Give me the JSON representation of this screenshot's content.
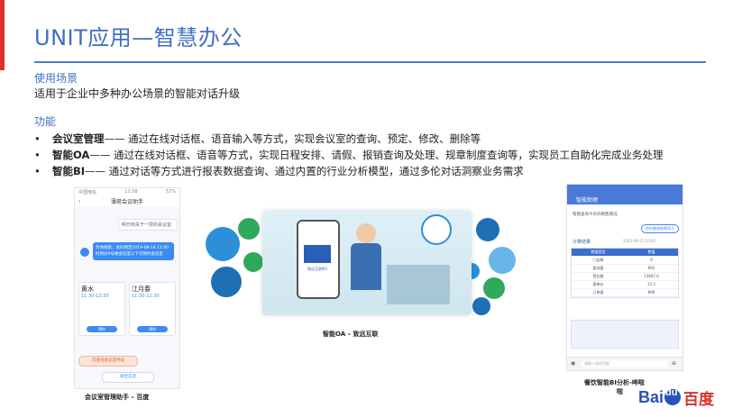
{
  "header": {
    "title": "UNIT应用—智慧办公"
  },
  "scenario": {
    "heading": "使用场景",
    "text": "适用于企业中多种办公场景的智能对话升级"
  },
  "features": {
    "heading": "功能",
    "items": [
      {
        "bullet": "•",
        "name": "会议室管理",
        "desc": " —— 通过在线对话框、语音输入等方式，实现会议室的查询、预定、修改、删除等"
      },
      {
        "bullet": "•",
        "name": "智能OA",
        "desc": " —— 通过在线对话框、语音等方式，实现日程安排、请假、报销查询及处理、规章制度查询等，实现员工自助化完成业务处理"
      },
      {
        "bullet": "•",
        "name": "智能BI",
        "desc": " —— 通过对话等方式进行报表数据查询、通过内置的行业分析模型，通过多伦对话洞察业务需求"
      }
    ]
  },
  "phone1": {
    "status_left": "中国电信",
    "status_time": "11:58",
    "status_right": "52%",
    "title": "薄荷会议助手",
    "user_msg": "明日到关于一层的会议室",
    "bot_msg": "为你搜索，会同预定2019-08-14 11:00时到达9号楼会议室以下可预约会议室",
    "rooms": [
      {
        "name": "黄水",
        "time": "11:30-12:30",
        "btn": "预约"
      },
      {
        "name": "江月春",
        "time": "11:30-12:30",
        "btn": "预约"
      }
    ],
    "pill_text": "可查询会议室时段",
    "footer_btn": "按住说话",
    "caption": "会议室管理助手 – 百度"
  },
  "center": {
    "logo_text": "致远互联M3",
    "caption": "智能OA – 致远互联",
    "colors": {
      "dark": "#1e6fb5",
      "mid": "#2c8fd8",
      "green": "#2fa95c",
      "light": "#69b5ea"
    }
  },
  "phone2": {
    "title": "智能助理",
    "question": "帮我查询今天的销售情况",
    "reply_btn": "你的查询结果如下",
    "section": "计算结果",
    "date": "2023-09-25 10:00",
    "rows": [
      [
        "数据类型",
        "数值"
      ],
      [
        "门店数",
        "8"
      ],
      [
        "客流量",
        "892"
      ],
      [
        "营业额",
        "13687.6"
      ],
      [
        "客单价",
        "15.3"
      ],
      [
        "订单量",
        "896"
      ]
    ],
    "input_placeholder": "请输入您的问题",
    "caption_line1": "餐饮智能BI分析-哗啦",
    "caption_line2": "啦"
  },
  "brand": {
    "latin1": "Bai",
    "latin2": "du",
    "cn": "百度"
  }
}
